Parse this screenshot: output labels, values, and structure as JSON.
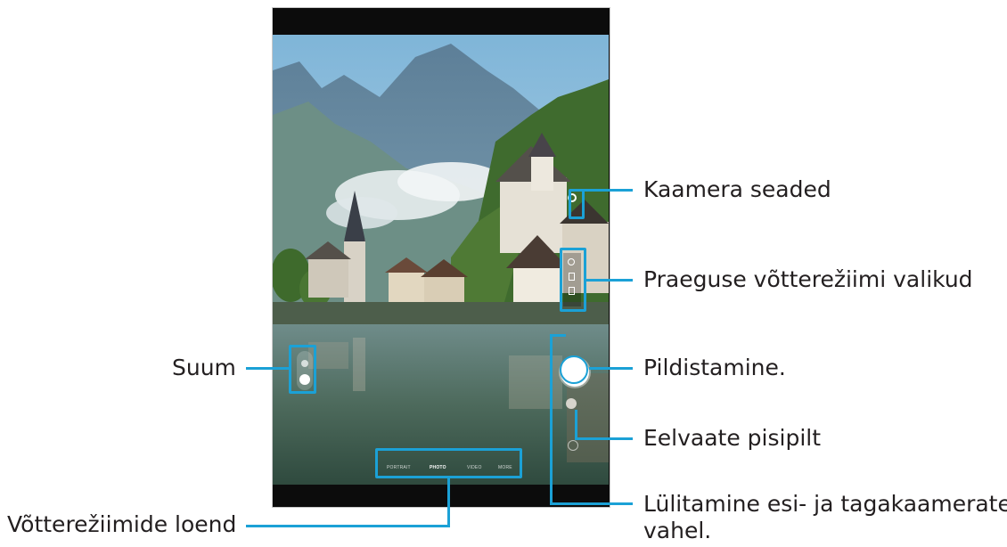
{
  "callouts": {
    "camera_settings": "Kaamera seaded",
    "mode_options": "Praeguse võtterežiimi valikud",
    "take_picture": "Pildistamine.",
    "preview_thumbnail": "Eelvaate pisipilt",
    "switch_camera_line1": "Lülitamine esi- ja tagakaamerate",
    "switch_camera_line2": "vahel.",
    "zoom": "Suum",
    "shooting_modes_list": "Võtterežiimide loend"
  },
  "camera_ui": {
    "modes": [
      "PORTRAIT",
      "PHOTO",
      "VIDEO",
      "MORE"
    ],
    "selected_mode": "PHOTO"
  },
  "colors": {
    "callout_line": "#1ba1d6",
    "text": "#231f20",
    "phone_bezel": "#0c0c0c"
  }
}
